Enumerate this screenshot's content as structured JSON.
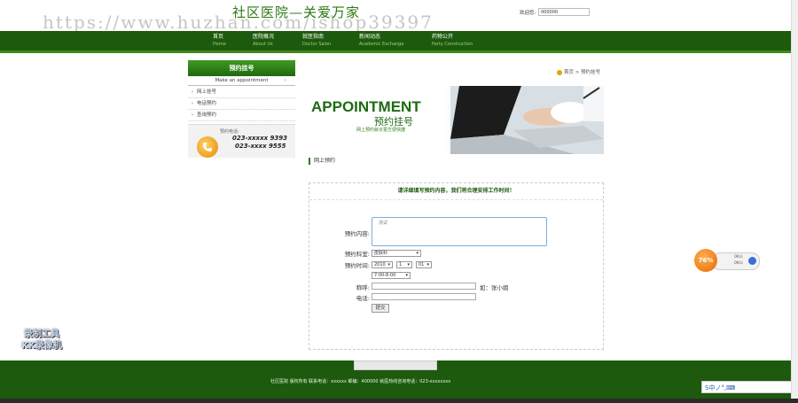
{
  "header": {
    "title": "社区医院—关爱万家",
    "watermark": "https://www.huzhan.com/ishop39397",
    "welcome_label": "欢迎您:",
    "welcome_value": "000000"
  },
  "nav": [
    {
      "cn": "首页",
      "en": "Home"
    },
    {
      "cn": "医院概况",
      "en": "About Us"
    },
    {
      "cn": "就医指南",
      "en": "Doctor Salon"
    },
    {
      "cn": "新闻动态",
      "en": "Academic Exchange"
    },
    {
      "cn": "药物公开",
      "en": "Party Construction"
    }
  ],
  "sidebar": {
    "title": "预约挂号",
    "subtitle": "Make an appointment",
    "items": [
      {
        "label": "网上挂号"
      },
      {
        "label": "电话预约"
      },
      {
        "label": "查询预约"
      }
    ],
    "contact_label": "预约电话:",
    "phone1": "023-xxxxx 9393",
    "phone2": "023-xxxx 9555"
  },
  "breadcrumb": {
    "home": "首页",
    "sep": ">",
    "current": "预约挂号"
  },
  "banner": {
    "en": "APPOINTMENT",
    "cn": "预约挂号",
    "desc": "网上预约就诊更方便快捷"
  },
  "section_title": "网上预约",
  "form": {
    "notice": "请详细填写预约内容，我们将合理安排工作时间！",
    "content_label": "预约内容:",
    "content_value": "测试",
    "dept_label": "预约科室:",
    "dept_value": "皮肤科",
    "time_label": "预约时间:",
    "year_value": "2010",
    "month_value": "1",
    "day_value": "01",
    "slot_value": "7:00-8:00",
    "name_label": "称呼:",
    "name_hint": "如：张小姐",
    "phone_label": "电话:",
    "submit_label": "提交"
  },
  "widgets": {
    "percent": "76%",
    "up_speed": "0K/s",
    "down_speed": "0K/s",
    "recorder_line1": "录制工具",
    "recorder_line2": "KK录像机",
    "ime_label": "S中ノ°,⌨"
  },
  "footer": {
    "text": "社区医院 版权所有 联系电话：xxxxxx 邮编：400000 就医热线咨询电话：023-xxxxxxxx"
  },
  "colors": {
    "brand_green": "#1d5a0d",
    "accent_green": "#2d7a12",
    "orange": "#e66a00"
  }
}
